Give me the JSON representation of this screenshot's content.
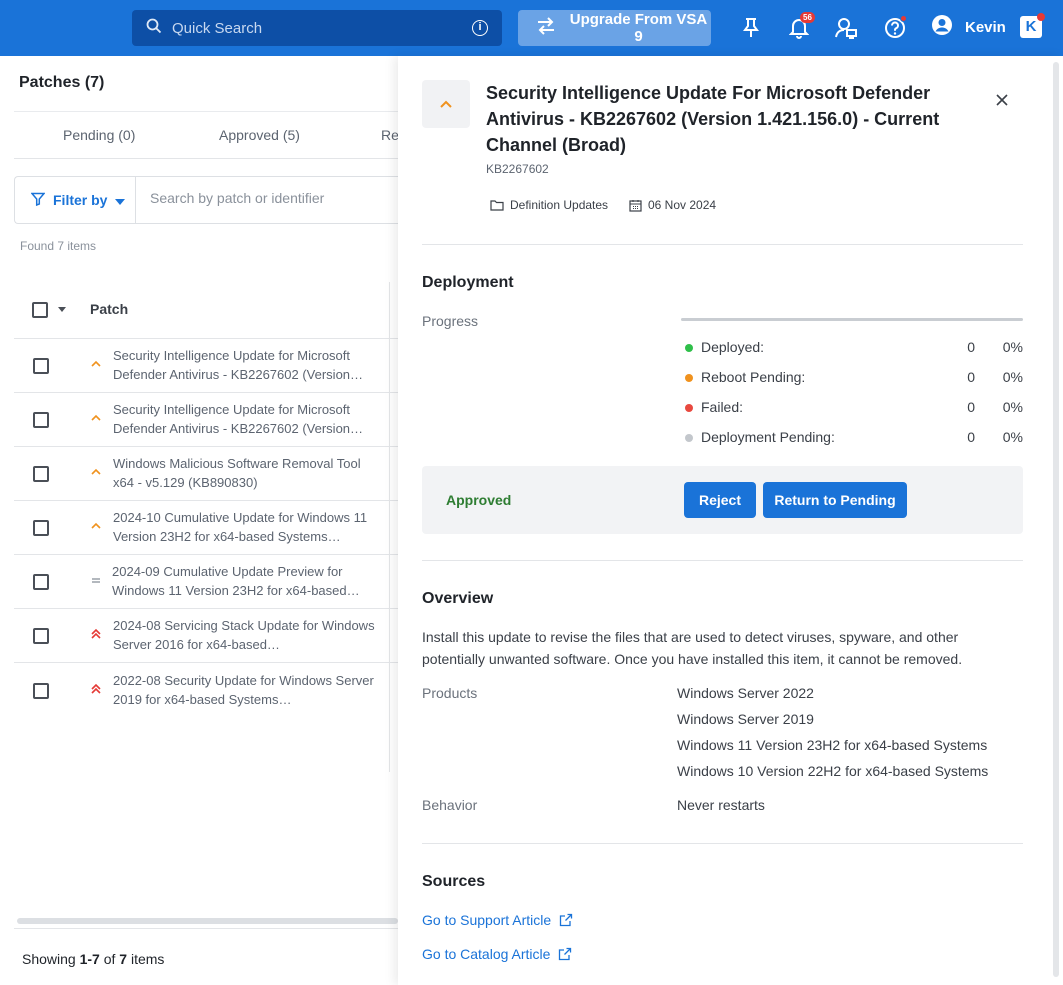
{
  "topbar": {
    "search_placeholder": "Quick Search",
    "upgrade_label": "Upgrade From VSA 9",
    "notifications_count": "56",
    "user_name": "Kevin",
    "brand_letter": "K"
  },
  "list": {
    "title": "Patches (7)",
    "tabs": [
      "Pending (0)",
      "Approved (5)",
      "Re"
    ],
    "filter_label": "Filter by",
    "search_placeholder": "Search by patch or identifier",
    "found_text": "Found 7 items",
    "column_patch": "Patch",
    "rows": [
      {
        "text": "Security Intelligence Update for Microsoft Defender Antivirus - KB2267602 (Version…",
        "priority": "medium"
      },
      {
        "text": "Security Intelligence Update for Microsoft Defender Antivirus - KB2267602 (Version…",
        "priority": "medium"
      },
      {
        "text": "Windows Malicious Software Removal Tool x64 - v5.129 (KB890830)",
        "priority": "medium"
      },
      {
        "text": "2024-10 Cumulative Update for Windows 11 Version 23H2 for x64-based Systems…",
        "priority": "medium"
      },
      {
        "text": "2024-09 Cumulative Update Preview for Windows 11 Version 23H2 for x64-based…",
        "priority": "low"
      },
      {
        "text": "2024-08 Servicing Stack Update for Windows Server 2016 for x64-based…",
        "priority": "high"
      },
      {
        "text": "2022-08 Security Update for Windows Server 2019 for x64-based Systems…",
        "priority": "high"
      }
    ],
    "footer": {
      "prefix": "Showing ",
      "range": "1-7",
      "of": " of ",
      "total": "7",
      "suffix": " items"
    }
  },
  "detail": {
    "title": "Security Intelligence Update For Microsoft Defender Antivirus - KB2267602 (Version 1.421.156.0) - Current Channel (Broad)",
    "kb": "KB2267602",
    "category": "Definition Updates",
    "date": "06 Nov 2024",
    "deployment": {
      "heading": "Deployment",
      "progress_label": "Progress",
      "progress_percent": 0,
      "stats": [
        {
          "label": "Deployed:",
          "count": "0",
          "percent": "0%",
          "color": "#2fbf4a"
        },
        {
          "label": "Reboot Pending:",
          "count": "0",
          "percent": "0%",
          "color": "#f0921e"
        },
        {
          "label": "Failed:",
          "count": "0",
          "percent": "0%",
          "color": "#e8493f"
        },
        {
          "label": "Deployment Pending:",
          "count": "0",
          "percent": "0%",
          "color": "#c3c7cc"
        }
      ],
      "status": "Approved",
      "reject_label": "Reject",
      "return_label": "Return to Pending"
    },
    "overview": {
      "heading": "Overview",
      "text": "Install this update to revise the files that are used to detect viruses, spyware, and other potentially unwanted software. Once you have installed this item, it cannot be removed.",
      "products_label": "Products",
      "products": [
        "Windows Server 2022",
        "Windows Server 2019",
        "Windows 11 Version 23H2 for x64-based Systems",
        "Windows 10 Version 22H2 for x64-based Systems"
      ],
      "behavior_label": "Behavior",
      "behavior": "Never restarts"
    },
    "sources": {
      "heading": "Sources",
      "support_link": "Go to Support Article",
      "catalog_link": "Go to Catalog Article"
    }
  },
  "colors": {
    "brand": "#1a73d8",
    "search_bg": "#0d4fa6",
    "priority_medium": "#f0921e",
    "priority_high": "#e53935",
    "priority_low": "#9aa0a8",
    "approved": "#2e7d32"
  }
}
